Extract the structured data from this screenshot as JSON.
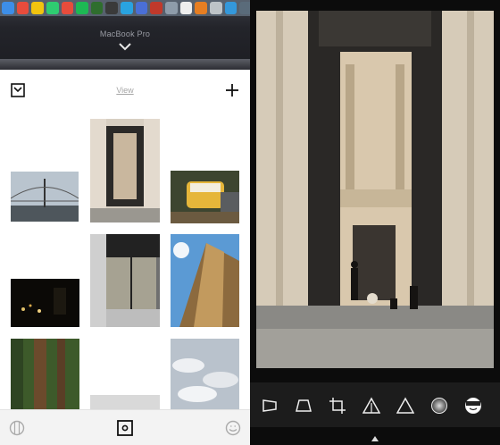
{
  "mac": {
    "label": "MacBook Pro"
  },
  "header": {
    "view_label": "View"
  },
  "icons": {
    "inbox": "inbox-icon",
    "add": "plus-icon",
    "chevron": "chevron-down-icon",
    "tab_filters": "filters-icon",
    "tab_studio": "studio-icon",
    "tab_profile": "face-icon",
    "tools": [
      "perspective-icon",
      "skew-icon",
      "crop-icon",
      "adjust-icon",
      "triangle-icon",
      "vignette-icon",
      "face-icon"
    ]
  },
  "gallery": [
    {
      "name": "bridge-photo"
    },
    {
      "name": "courtyard-photo"
    },
    {
      "name": "van-photo"
    },
    {
      "name": "night-photo"
    },
    {
      "name": "window-photo"
    },
    {
      "name": "skyscraper-photo"
    },
    {
      "name": "forest-photo"
    },
    {
      "name": "clouds-photo"
    },
    {
      "name": "sky-photo"
    }
  ],
  "colors": {
    "accent": "#111111",
    "toolbar_bg": "#1c1c1c"
  }
}
